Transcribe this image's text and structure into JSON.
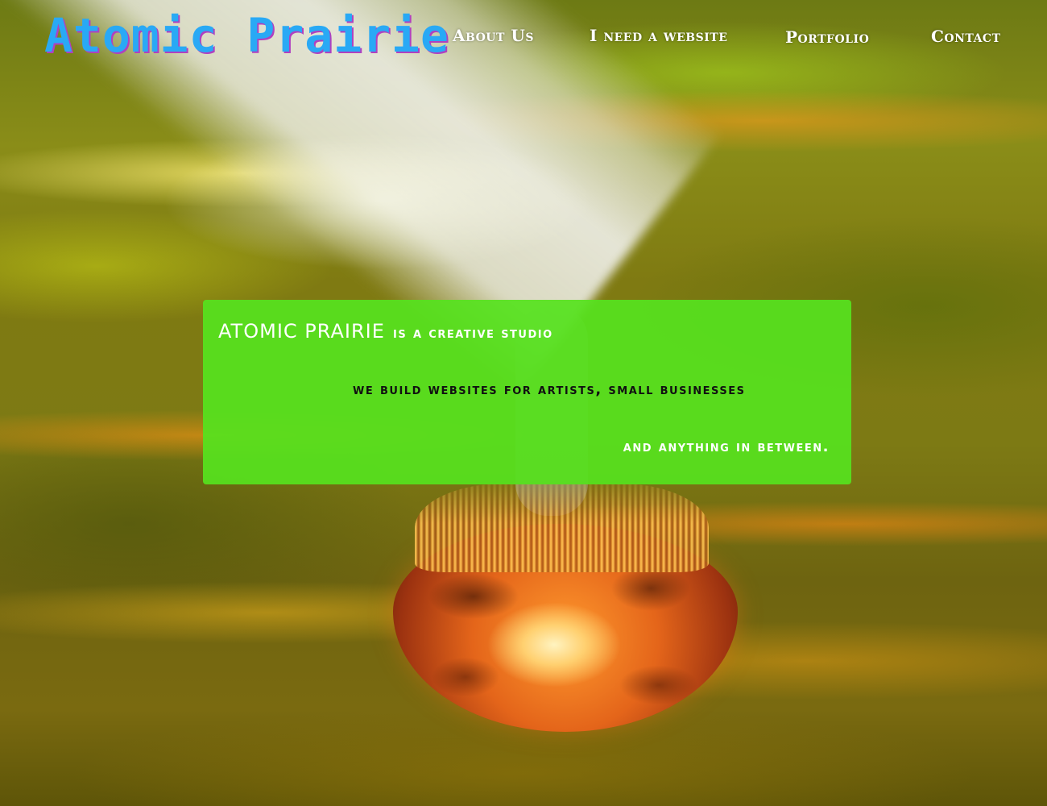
{
  "site": {
    "logo_text": "Atomic Prairie"
  },
  "nav": {
    "items": [
      {
        "label": "About Us"
      },
      {
        "label": "I need a website"
      },
      {
        "label": "Portfolio"
      },
      {
        "label": "Contact"
      }
    ]
  },
  "hero": {
    "brand": "ATOMIC PRAIRIE",
    "line1": "is a creative studio",
    "line2": "we build websites for artists, small businesses",
    "line3": "and anything in between."
  },
  "colors": {
    "logo": "#29a9f5",
    "logo_shadow": "#b040c0",
    "hero_panel": "#56e21e",
    "nav_text": "#ffffff"
  },
  "background": {
    "icon": "apocalyptic-sky-with-flaming-prairie-boulder"
  }
}
